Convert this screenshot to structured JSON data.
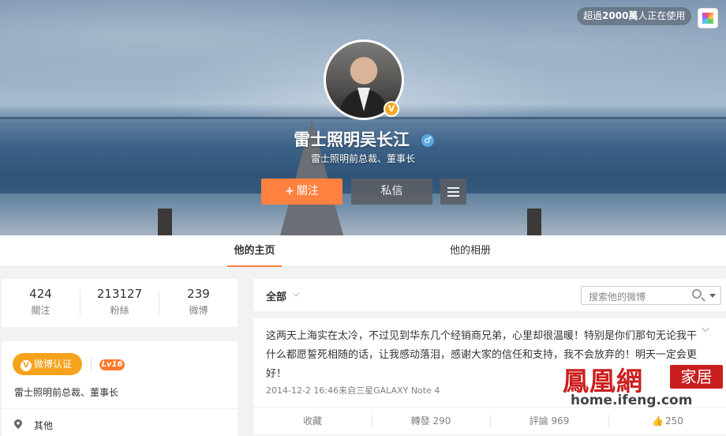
{
  "top_badge": {
    "prefix": "超過",
    "count": "2000萬",
    "suffix": "人正在使用"
  },
  "profile": {
    "name": "雷士照明吴长江",
    "gender_icon": "♂",
    "verified_icon": "V",
    "subtitle": "雷士照明前总裁、董事长",
    "follow_plus": "+",
    "follow_label": "關注",
    "message_label": "私信"
  },
  "tabs": [
    {
      "label": "他的主页",
      "active": true
    },
    {
      "label": "他的相册",
      "active": false
    }
  ],
  "stats": [
    {
      "value": "424",
      "label": "關注"
    },
    {
      "value": "213127",
      "label": "粉絲"
    },
    {
      "value": "239",
      "label": "微博"
    }
  ],
  "info": {
    "verify_label": "微博认证",
    "verify_icon": "V",
    "level": "Lv16",
    "desc": "雷士照明前总裁、董事长",
    "location": "其他"
  },
  "filter": {
    "all_label": "全部",
    "chevron": "⌵",
    "search_placeholder": "搜索他的微博"
  },
  "post": {
    "more_icon": "⌵",
    "text": "这两天上海实在太冷，不过见到华东几个经销商兄弟，心里却很温暖！特别是你们那句无论我干什么都愿誓死相随的话，让我感动落泪，感谢大家的信任和支持，我不会放弃的！明天一定会更好！",
    "meta": "2014-12-2 16:46来自三星GALAXY Note 4",
    "actions": {
      "favorite": "收藏",
      "repost": "轉發 290",
      "comment": "評論 969",
      "like_icon": "👍",
      "like": "250"
    }
  },
  "watermark": {
    "brand_cn": "鳳凰網",
    "tag": "家居",
    "url": "home.ifeng.com"
  },
  "colors": {
    "accent": "#ff8140",
    "verify": "#f7a21d",
    "brand_red": "#c81e1e"
  }
}
